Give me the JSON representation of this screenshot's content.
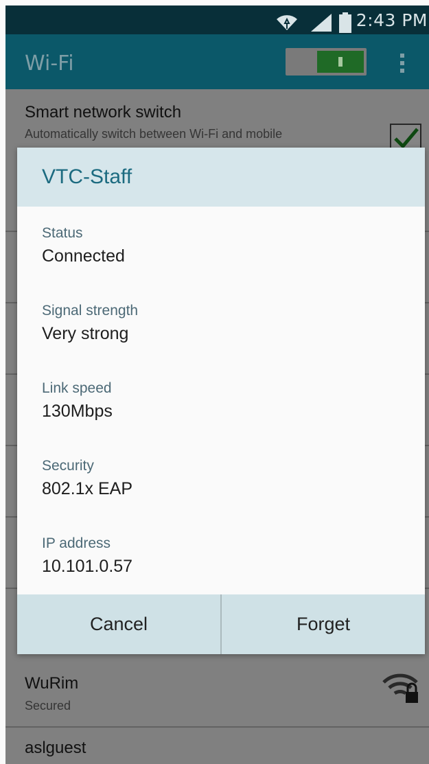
{
  "status_bar": {
    "time": "2:43 PM"
  },
  "app_bar": {
    "title": "Wi-Fi",
    "wifi_enabled": true
  },
  "background_list": {
    "smart_switch": {
      "title": "Smart network switch",
      "subtitle": "Automatically switch between Wi-Fi and mobile",
      "checked": true
    },
    "networks": [
      {
        "name": "WuRim",
        "status": "Secured",
        "icon": "wifi-locked-icon"
      },
      {
        "name": "aslguest"
      }
    ]
  },
  "dialog": {
    "title": "VTC-Staff",
    "details": [
      {
        "label": "Status",
        "value": "Connected"
      },
      {
        "label": "Signal strength",
        "value": "Very strong"
      },
      {
        "label": "Link speed",
        "value": "130Mbps"
      },
      {
        "label": "Security",
        "value": "802.1x EAP"
      },
      {
        "label": "IP address",
        "value": "10.101.0.57"
      }
    ],
    "buttons": {
      "cancel": "Cancel",
      "forget": "Forget"
    }
  },
  "colors": {
    "status_bar": "#082f39",
    "app_bar": "#0b5869",
    "dialog_header": "#d6e6eb",
    "dialog_title": "#1c6b80",
    "button_bar": "#cfe1e6"
  }
}
